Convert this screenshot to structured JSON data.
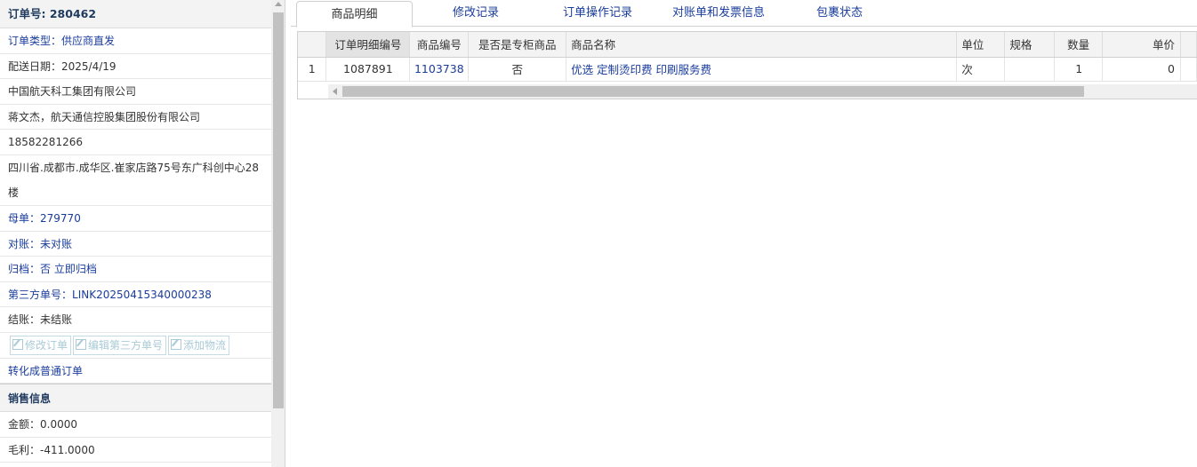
{
  "order": {
    "header": "订单号: 280462",
    "type": "订单类型：供应商直发",
    "delivery_date": "配送日期：2025/4/19",
    "company": "中国航天科工集团有限公司",
    "contact": "蒋文杰，航天通信控股集团股份有限公司",
    "phone": "18582281266",
    "address": "四川省.成都市.成华区.崔家店路75号东广科创中心28楼",
    "parent_label": "母单：",
    "parent_value": "279770",
    "reconcile_label": "对账：",
    "reconcile_value": "未对账",
    "archive_label": "归档：",
    "archive_value": "否 立即归档",
    "third_party_label": "第三方单号：",
    "third_party_value": "LINK20250415340000238",
    "settle_label": "结账：",
    "settle_value": "未结账",
    "btn_edit_order": "修改订单",
    "btn_edit_third": "编辑第三方单号",
    "btn_add_logistics": "添加物流",
    "convert_link": "转化成普通订单"
  },
  "sales": {
    "title": "销售信息",
    "amount": "金额：0.0000",
    "profit": "毛利：-411.0000"
  },
  "tabs": [
    "商品明细",
    "修改记录",
    "订单操作记录",
    "对账单和发票信息",
    "包裹状态"
  ],
  "grid": {
    "columns": [
      "订单明细编号",
      "商品编号",
      "是否是专柜商品",
      "商品名称",
      "单位",
      "规格",
      "数量",
      "单价"
    ],
    "rows": [
      {
        "rownum": "1",
        "detail_id": "1087891",
        "product_id": "1103738",
        "is_counter": "否",
        "name": "优选 定制烫印费 印刷服务费",
        "unit": "次",
        "spec": "",
        "qty": "1",
        "price": "0"
      }
    ]
  }
}
